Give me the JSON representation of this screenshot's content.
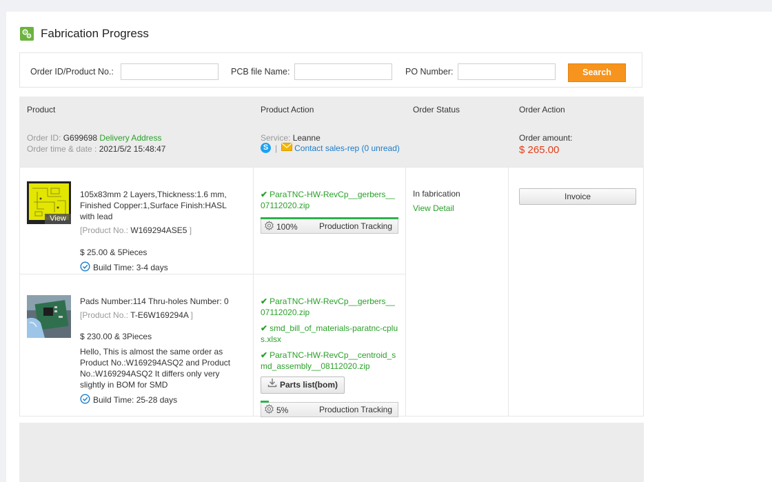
{
  "page": {
    "title": "Fabrication Progress",
    "icon": "gear-cog-icon"
  },
  "search": {
    "order_label": "Order ID/Product No.:",
    "order_value": "",
    "pcb_label": "PCB file Name:",
    "pcb_value": "",
    "po_label": "PO Number:",
    "po_value": "",
    "button": "Search"
  },
  "table_headers": [
    "Product",
    "Product Action",
    "Order Status",
    "Order Action"
  ],
  "order": {
    "id_label": "Order ID:",
    "id": "G699698",
    "delivery": "Delivery Address",
    "time_label": "Order time & date :",
    "time": "2021/5/2 15:48:47",
    "service_label": "Service:",
    "service": "Leanne",
    "separator": "|",
    "contact": "Contact sales-rep (0 unread)",
    "amount_label": "Order amount:",
    "amount": "$ 265.00",
    "status": "In fabrication",
    "view_detail": "View Detail",
    "invoice": "Invoice"
  },
  "products": [
    {
      "desc": "105x83mm 2 Layers,Thickness:1.6 mm, Finished Copper:1,Surface Finish:HASL with lead",
      "product_no_label": "[Product No.:",
      "product_no": "W169294ASE5",
      "product_no_close": "]",
      "price": "$ 25.00 & 5Pieces",
      "build_time": "Build Time: 3-4 days",
      "view_label": "View",
      "files": [
        "ParaTNC-HW-RevCp__gerbers__07112020.zip"
      ],
      "progress": 100,
      "progress_text": "100%",
      "tracking_label": "Production Tracking"
    },
    {
      "desc": "Pads Number:114 Thru-holes Number: 0",
      "product_no_label": "[Product No.:",
      "product_no": "T-E6W169294A",
      "product_no_close": "]",
      "price": "$ 230.00 & 3Pieces",
      "note": "Hello, This is almost the same order as Product No.:W169294ASQ2 and Product No.:W169294ASQ2 It differs only very slightly in BOM for SMD",
      "build_time": "Build Time: 25-28 days",
      "files": [
        "ParaTNC-HW-RevCp__gerbers__07112020.zip",
        "smd_bill_of_materials-paratnc-cplus.xlsx",
        "ParaTNC-HW-RevCp__centroid_smd_assembly__08112020.zip"
      ],
      "parts_button": "Parts list(bom)",
      "progress": 5,
      "progress_text": "5%",
      "tracking_label": "Production Tracking"
    }
  ],
  "colors": {
    "accent_orange": "#f7941d",
    "green": "#2aa02a",
    "blue": "#1a7bc9",
    "price_red": "#e0401a",
    "progress_green": "#2bb24c"
  }
}
